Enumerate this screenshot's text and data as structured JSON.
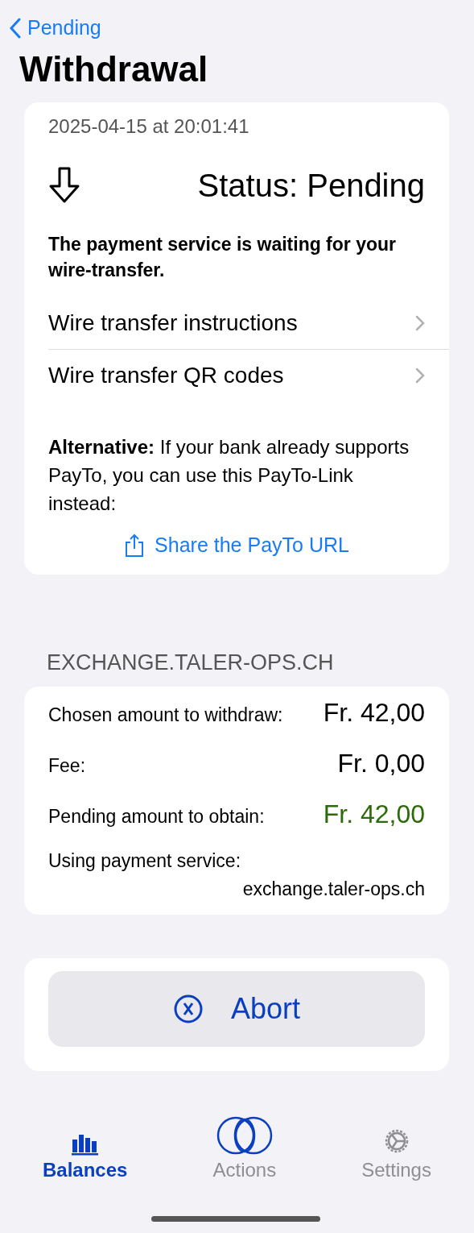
{
  "nav": {
    "back_label": "Pending"
  },
  "title": "Withdrawal",
  "status_card": {
    "timestamp": "2025-04-15 at 20:01:41",
    "status_label": "Status:",
    "status_value": "Pending",
    "message": "The payment service is waiting for your wire-transfer.",
    "links": [
      {
        "label": "Wire transfer instructions"
      },
      {
        "label": "Wire transfer QR codes"
      }
    ],
    "alternative_text": "**Alternative:** If your bank already supports PayTo, you can use this PayTo-Link instead:",
    "share_button": "Share the PayTo URL"
  },
  "exchange": {
    "heading": "EXCHANGE.TALER-OPS.CH",
    "rows": [
      {
        "label": "Chosen amount to withdraw:",
        "value": "Fr. 42,00",
        "kind": "amount"
      },
      {
        "label": "Fee:",
        "value": "Fr. 0,00",
        "kind": "amount"
      },
      {
        "label": "Pending amount to obtain:",
        "value": "Fr. 42,00",
        "kind": "highlight"
      },
      {
        "label": "Using payment service:",
        "value": "exchange.taler-ops.ch",
        "kind": "stacked"
      }
    ]
  },
  "abort_button": "Abort",
  "tabs": [
    {
      "label": "Balances",
      "selected": true
    },
    {
      "label": "Actions",
      "selected": false
    },
    {
      "label": "Settings",
      "selected": false
    }
  ]
}
